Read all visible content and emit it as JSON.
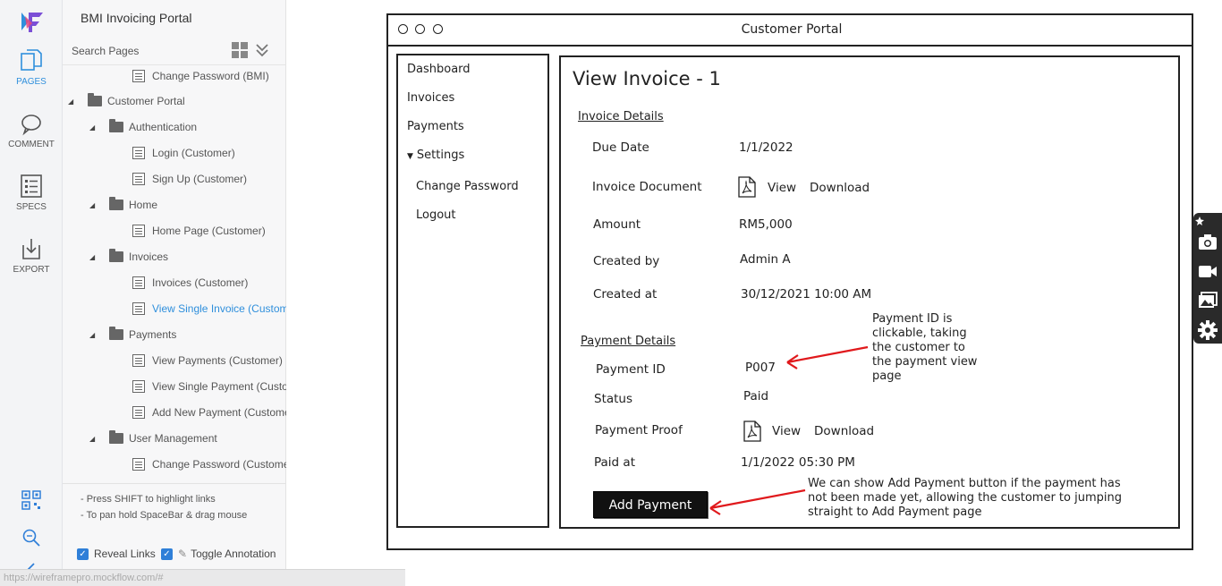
{
  "rail": {
    "items": [
      {
        "label": "PAGES"
      },
      {
        "label": "COMMENT"
      },
      {
        "label": "SPECS"
      },
      {
        "label": "EXPORT"
      }
    ]
  },
  "panel": {
    "title": "BMI Invoicing Portal",
    "search_placeholder": "Search Pages",
    "tree": [
      "Change Password (BMI)",
      "Customer Portal",
      "Authentication",
      "Login (Customer)",
      "Sign Up (Customer)",
      "Home",
      "Home Page (Customer)",
      "Invoices",
      "Invoices (Customer)",
      "View Single Invoice (Custome",
      "Payments",
      "View Payments (Customer)",
      "View Single Payment (Custom",
      "Add New Payment (Customer",
      "User Management",
      "Change Password (Customer)"
    ],
    "hints": [
      "- Press SHIFT to highlight links",
      "- To pan hold SpaceBar & drag mouse"
    ],
    "reveal_links": "Reveal Links",
    "toggle_annotation": "Toggle Annotation",
    "status_url": "https://wireframepro.mockflow.com/#"
  },
  "wireframe": {
    "window_title": "Customer Portal",
    "nav": [
      "Dashboard",
      "Invoices",
      "Payments",
      "Settings",
      "Change Password",
      "Logout"
    ],
    "page_title": "View Invoice - 1",
    "invoice_section": "Invoice Details",
    "due_date_label": "Due Date",
    "due_date_value": "1/1/2022",
    "invoice_doc_label": "Invoice Document",
    "view": "View",
    "download": "Download",
    "amount_label": "Amount",
    "amount_value": "RM5,000",
    "created_by_label": "Created by",
    "created_by_value": "Admin A",
    "created_at_label": "Created at",
    "created_at_value": "30/12/2021 10:00 AM",
    "payment_section": "Payment Details",
    "payment_id_label": "Payment ID",
    "payment_id_value": "P007",
    "status_label": "Status",
    "status_value": "Paid",
    "payment_proof_label": "Payment Proof",
    "paid_at_label": "Paid at",
    "paid_at_value": "1/1/2022 05:30 PM",
    "add_payment": "Add Payment",
    "note1": [
      "Payment ID is",
      "clickable, taking",
      "the customer to",
      "the payment view",
      "page"
    ],
    "note2": [
      "We can show Add Payment button if the payment has",
      "not been made yet, allowing the customer to jumping",
      "straight to Add Payment page"
    ]
  },
  "colors": {
    "accent": "#2f8fdc",
    "arrow": "#e0191c"
  }
}
